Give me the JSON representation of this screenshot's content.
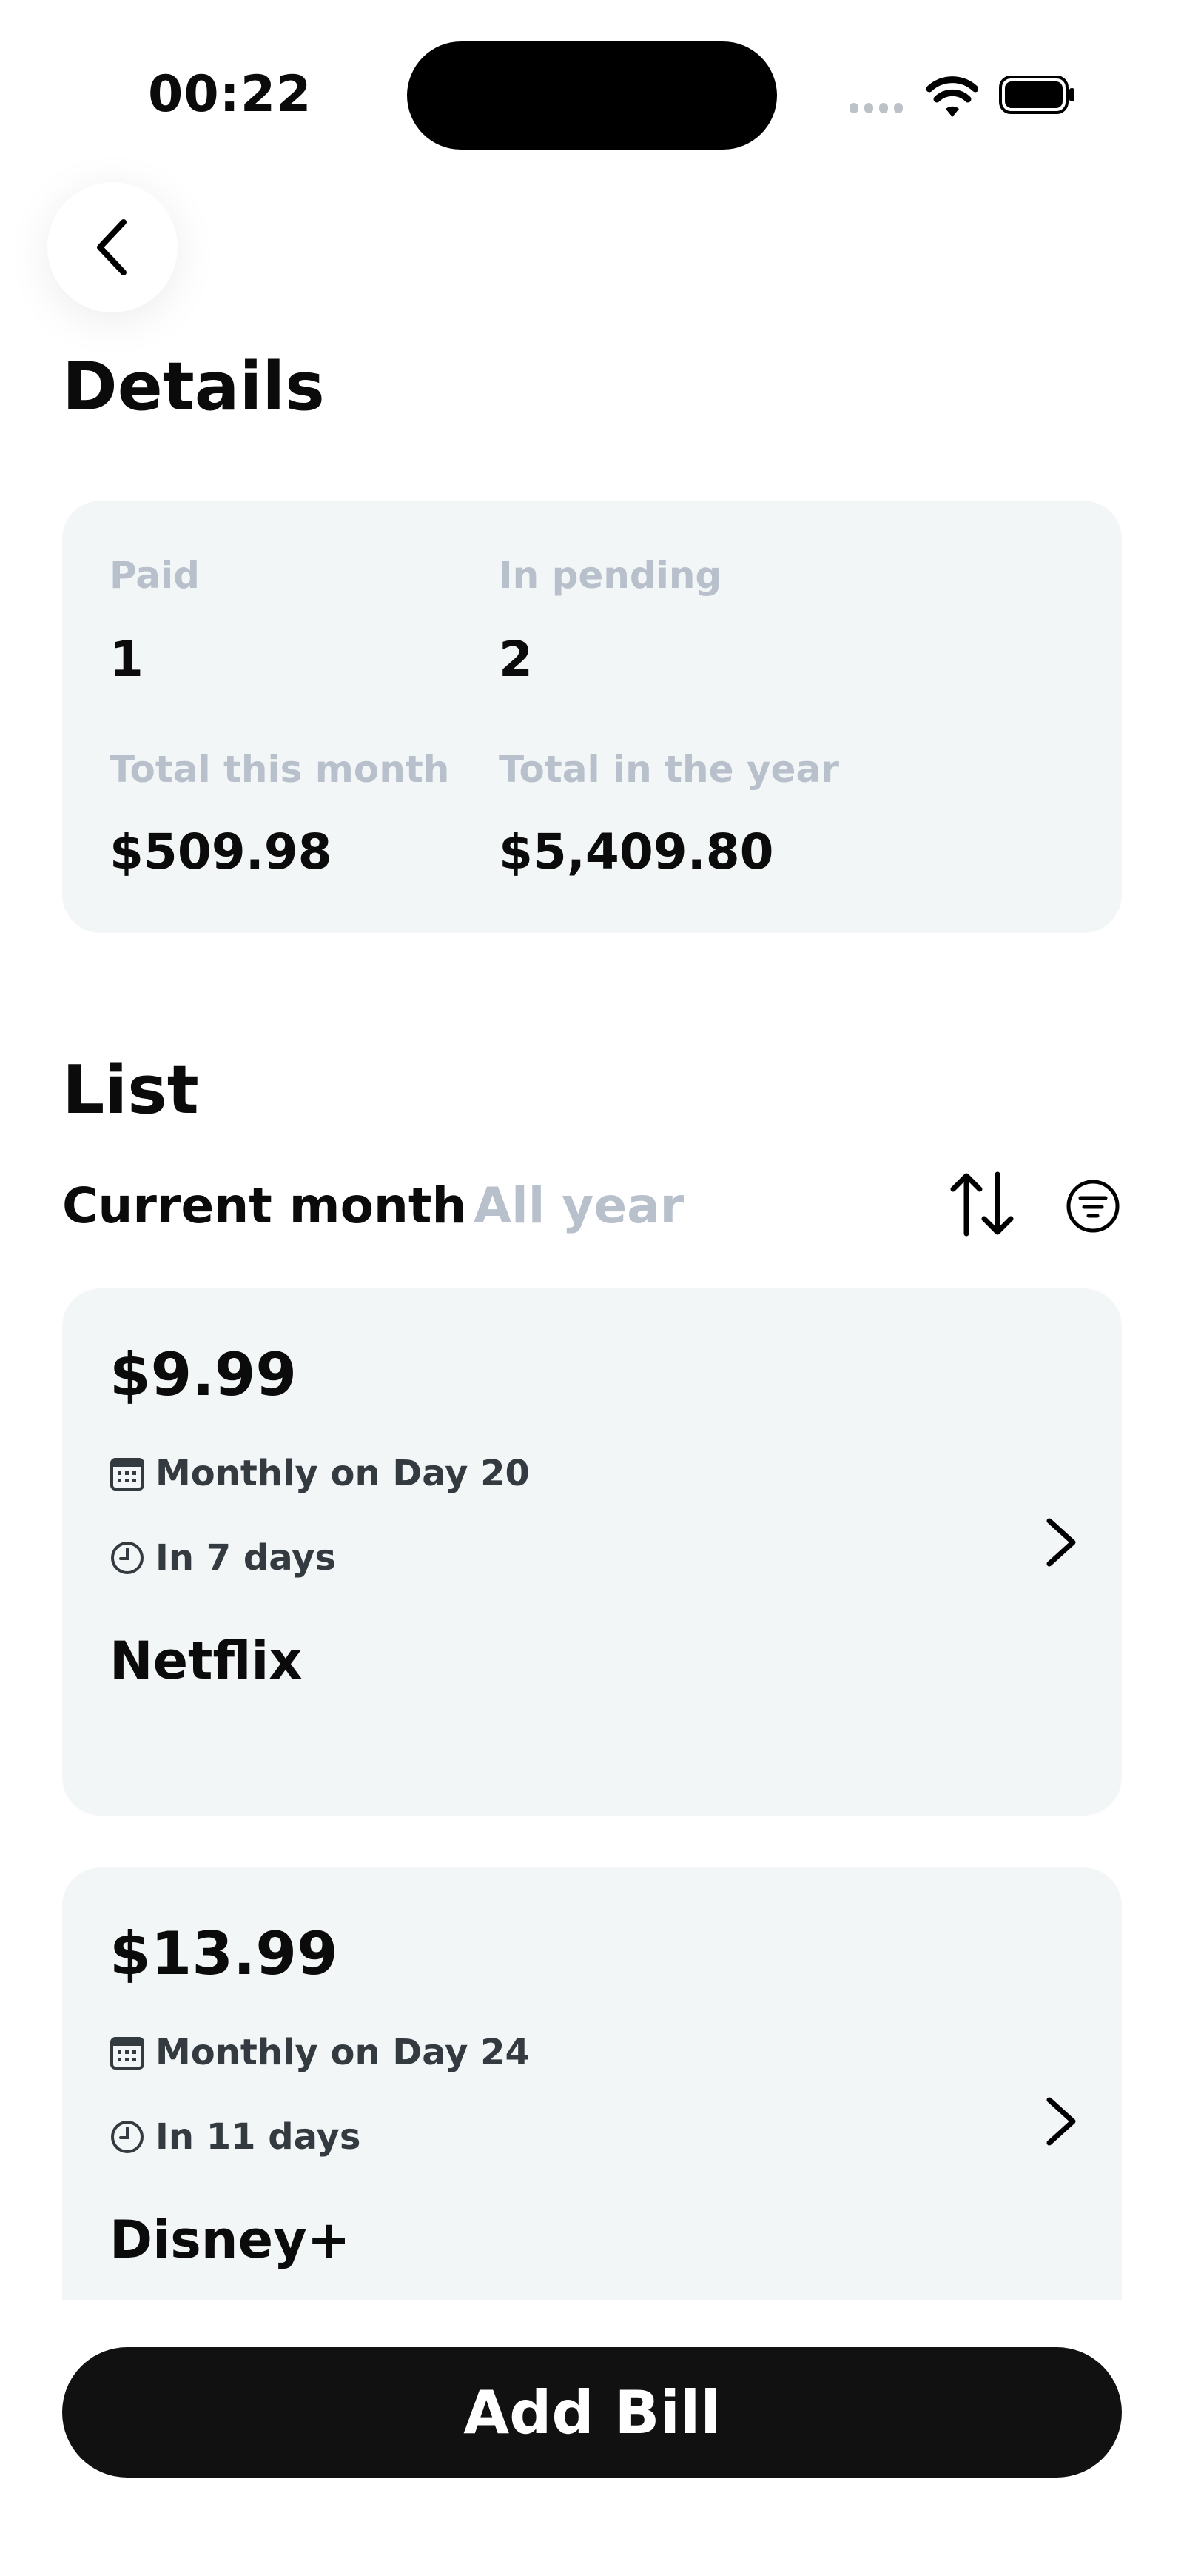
{
  "status_bar": {
    "time": "00:22"
  },
  "header": {
    "back_icon": "chevron-left-icon",
    "title": "Details"
  },
  "summary": {
    "paid": {
      "label": "Paid",
      "value": "1"
    },
    "pending": {
      "label": "In pending",
      "value": "2"
    },
    "total_month": {
      "label": "Total this month",
      "value": "$509.98"
    },
    "total_year": {
      "label": "Total in the year",
      "value": "$5,409.80"
    }
  },
  "list": {
    "title": "List",
    "tabs": {
      "current": "Current month",
      "all": "All year"
    },
    "sort_icon": "sort-arrows-icon",
    "filter_icon": "filter-icon",
    "bills": [
      {
        "amount": "$9.99",
        "schedule": "Monthly on Day 20",
        "due": "In 7 days",
        "name": "Netflix"
      },
      {
        "amount": "$13.99",
        "schedule": "Monthly on Day 24",
        "due": "In 11 days",
        "name": "Disney+"
      }
    ]
  },
  "actions": {
    "add_bill": "Add Bill"
  },
  "colors": {
    "card": "#f3f6f7",
    "muted_text": "#b8c0cc",
    "button": "#111111"
  }
}
